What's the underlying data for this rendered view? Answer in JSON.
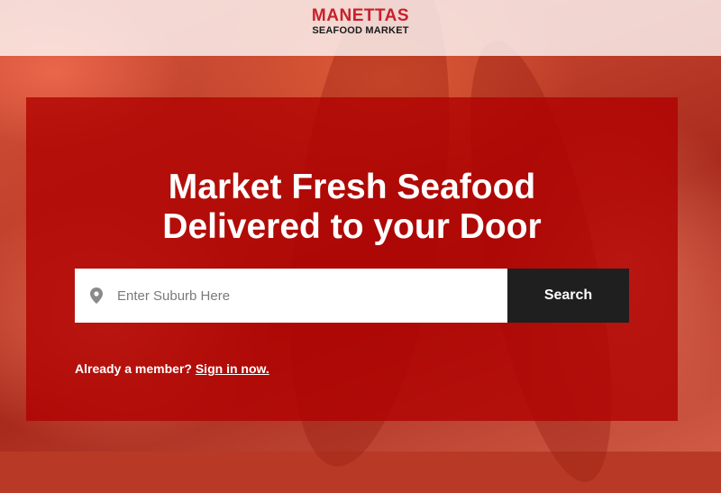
{
  "brand": {
    "name_top": "MANETTAS",
    "name_bottom": "SEAFOOD MARKET",
    "accent_color": "#c8202a"
  },
  "hero": {
    "headline_line1": "Market Fresh Seafood",
    "headline_line2": "Delivered to your Door",
    "panel_color": "#b00000"
  },
  "search": {
    "icon": "location-pin-icon",
    "placeholder": "Enter Suburb Here",
    "value": "",
    "button_label": "Search"
  },
  "member": {
    "prompt": "Already a member?",
    "link_label": "Sign in now."
  }
}
